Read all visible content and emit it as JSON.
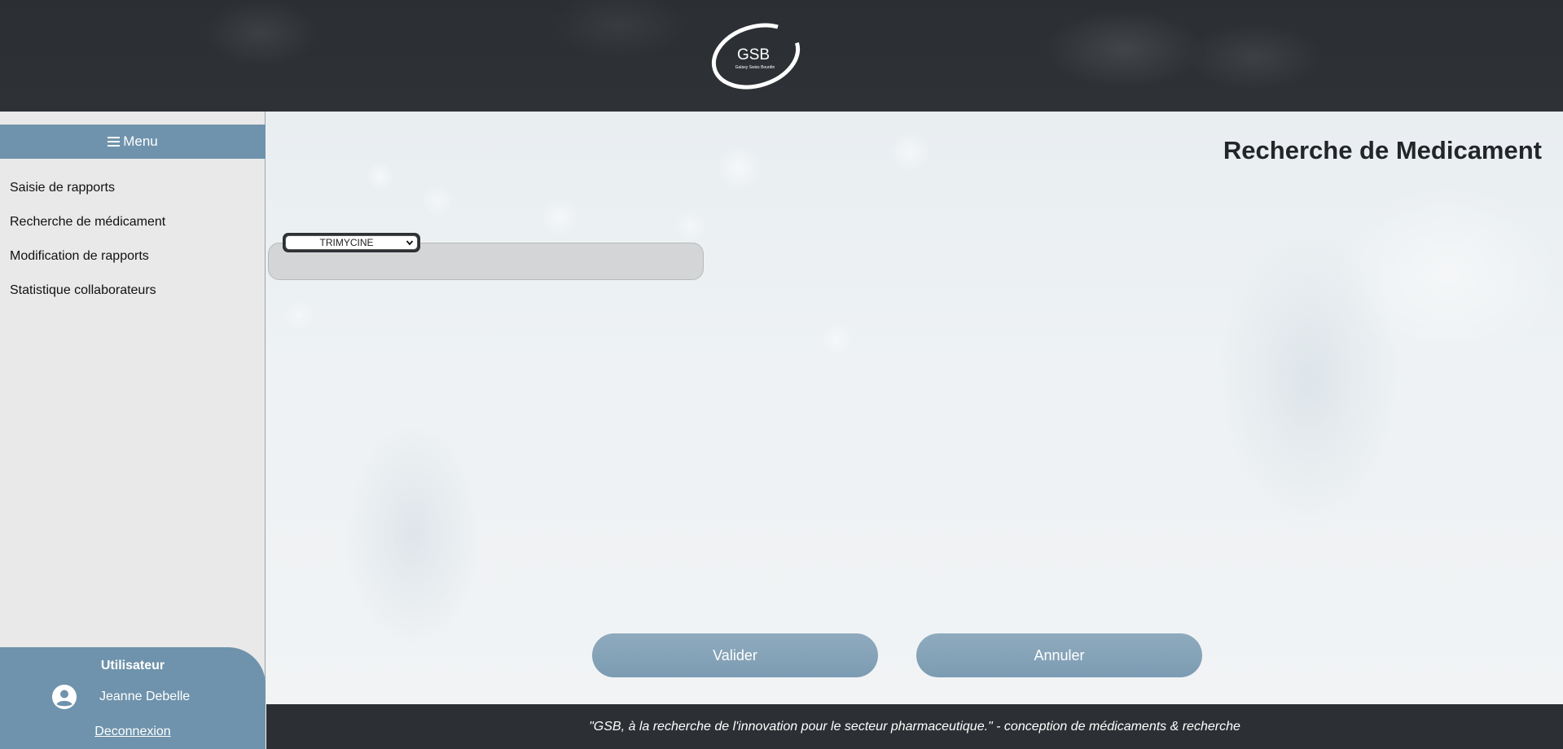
{
  "header": {
    "logo": {
      "text": "GSB",
      "tagline": "Galaxy Swiss Bourdin"
    }
  },
  "sidebar": {
    "menu_label": "Menu",
    "items": [
      {
        "label": "Saisie de rapports"
      },
      {
        "label": "Recherche de médicament"
      },
      {
        "label": "Modification de rapports"
      },
      {
        "label": "Statistique collaborateurs"
      }
    ],
    "user": {
      "title": "Utilisateur",
      "name": "Jeanne Debelle",
      "logout_label": "Deconnexion"
    }
  },
  "main": {
    "title": "Recherche de Medicament",
    "medicament_select": {
      "selected": "TRIMYCINE"
    },
    "validate_label": "Valider",
    "cancel_label": "Annuler"
  },
  "footer": {
    "text": "\"GSB, à la recherche de l'innovation pour le secteur pharmaceutique.\" - conception de médicaments & recherche"
  },
  "colors": {
    "header_bg": "#2c3034",
    "accent": "#6f93ac",
    "sidebar_bg": "#e9e9e9",
    "button": "#84a2b8"
  }
}
